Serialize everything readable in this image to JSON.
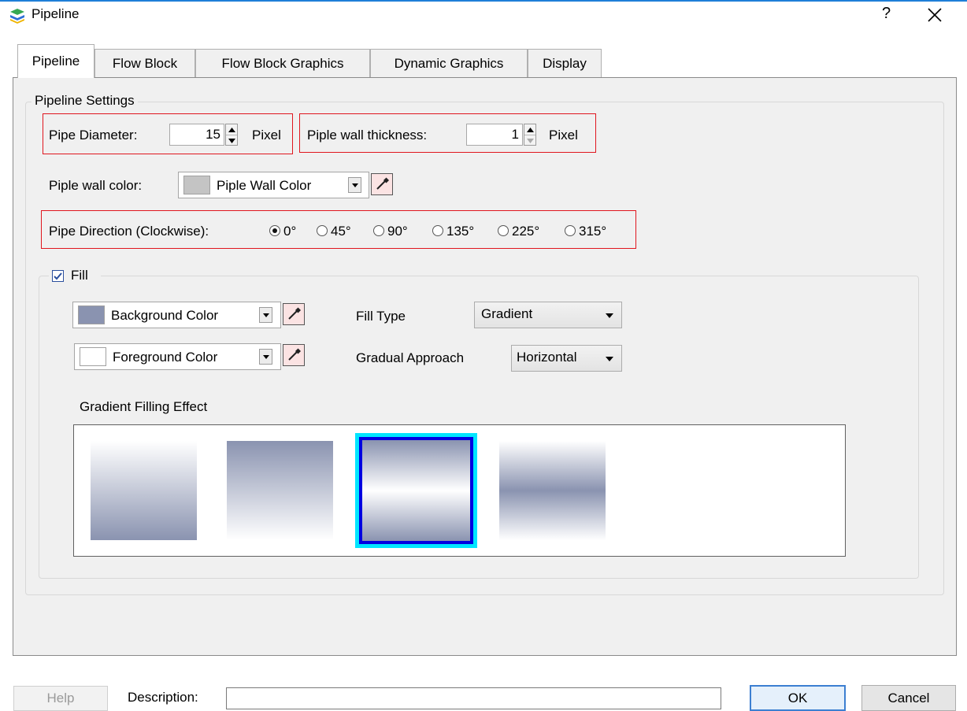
{
  "window": {
    "title": "Pipeline",
    "help": "?"
  },
  "tabs": [
    {
      "label": "Pipeline"
    },
    {
      "label": "Flow Block"
    },
    {
      "label": "Flow Block Graphics"
    },
    {
      "label": "Dynamic Graphics"
    },
    {
      "label": "Display"
    }
  ],
  "settings": {
    "group_title": "Pipeline Settings",
    "pipe_diameter": {
      "label": "Pipe Diameter:",
      "value": "15",
      "unit": "Pixel"
    },
    "wall_thickness": {
      "label": "Piple wall thickness:",
      "value": "1",
      "unit": "Pixel"
    },
    "wall_color": {
      "label": "Piple wall color:",
      "value": "Piple Wall Color",
      "swatch": "#c4c4c4"
    },
    "direction": {
      "label": "Pipe Direction (Clockwise):",
      "options": [
        "0°",
        "45°",
        "90°",
        "135°",
        "225°",
        "315°"
      ],
      "selected": "0°"
    }
  },
  "fill": {
    "label": "Fill",
    "checked": true,
    "background": {
      "value": "Background Color",
      "swatch": "#8a93b0"
    },
    "foreground": {
      "value": "Foreground Color",
      "swatch": "#ffffff"
    },
    "fill_type": {
      "label": "Fill Type",
      "value": "Gradient"
    },
    "approach": {
      "label": "Gradual Approach",
      "value": "Horizontal"
    },
    "effect_title": "Gradient Filling Effect",
    "gradient_colors": {
      "dark": "#8a93b0",
      "light": "#ffffff"
    },
    "selected_effect_index": 2
  },
  "footer": {
    "help": "Help",
    "description_label": "Description:",
    "description_value": "",
    "ok": "OK",
    "cancel": "Cancel"
  },
  "colors": {
    "accent": "#1e7fd8",
    "highlight_box": "#e0161e",
    "selection_outer": "#00e5ff",
    "selection_inner": "#0000e0"
  }
}
